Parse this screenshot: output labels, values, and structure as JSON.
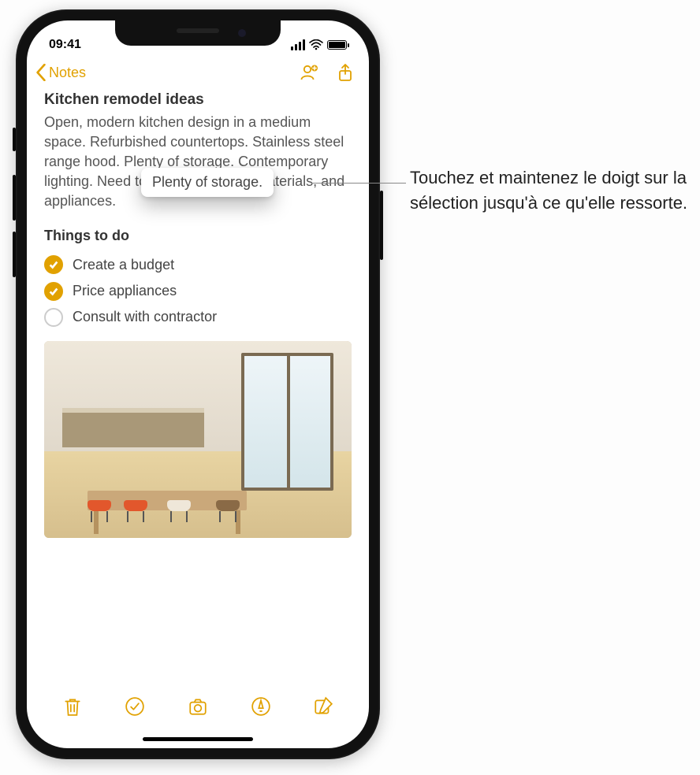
{
  "statusbar": {
    "time": "09:41"
  },
  "nav": {
    "back_label": "Notes"
  },
  "note": {
    "title": "Kitchen remodel ideas",
    "body": "Open, modern kitchen design in a medium space. Refurbished countertops. Stainless steel range hood. Plenty of storage. Contemporary lighting. Need to research colors, materials, and appliances.",
    "section_title": "Things to do",
    "todos": [
      {
        "label": "Create a budget",
        "done": true
      },
      {
        "label": "Price appliances",
        "done": true
      },
      {
        "label": "Consult with contractor",
        "done": false
      }
    ]
  },
  "lifted_text": "Plenty of storage.",
  "callout": "Touchez et maintenez le doigt sur la sélection jusqu'à ce qu'elle ressorte.",
  "colors": {
    "accent": "#e1a100"
  }
}
